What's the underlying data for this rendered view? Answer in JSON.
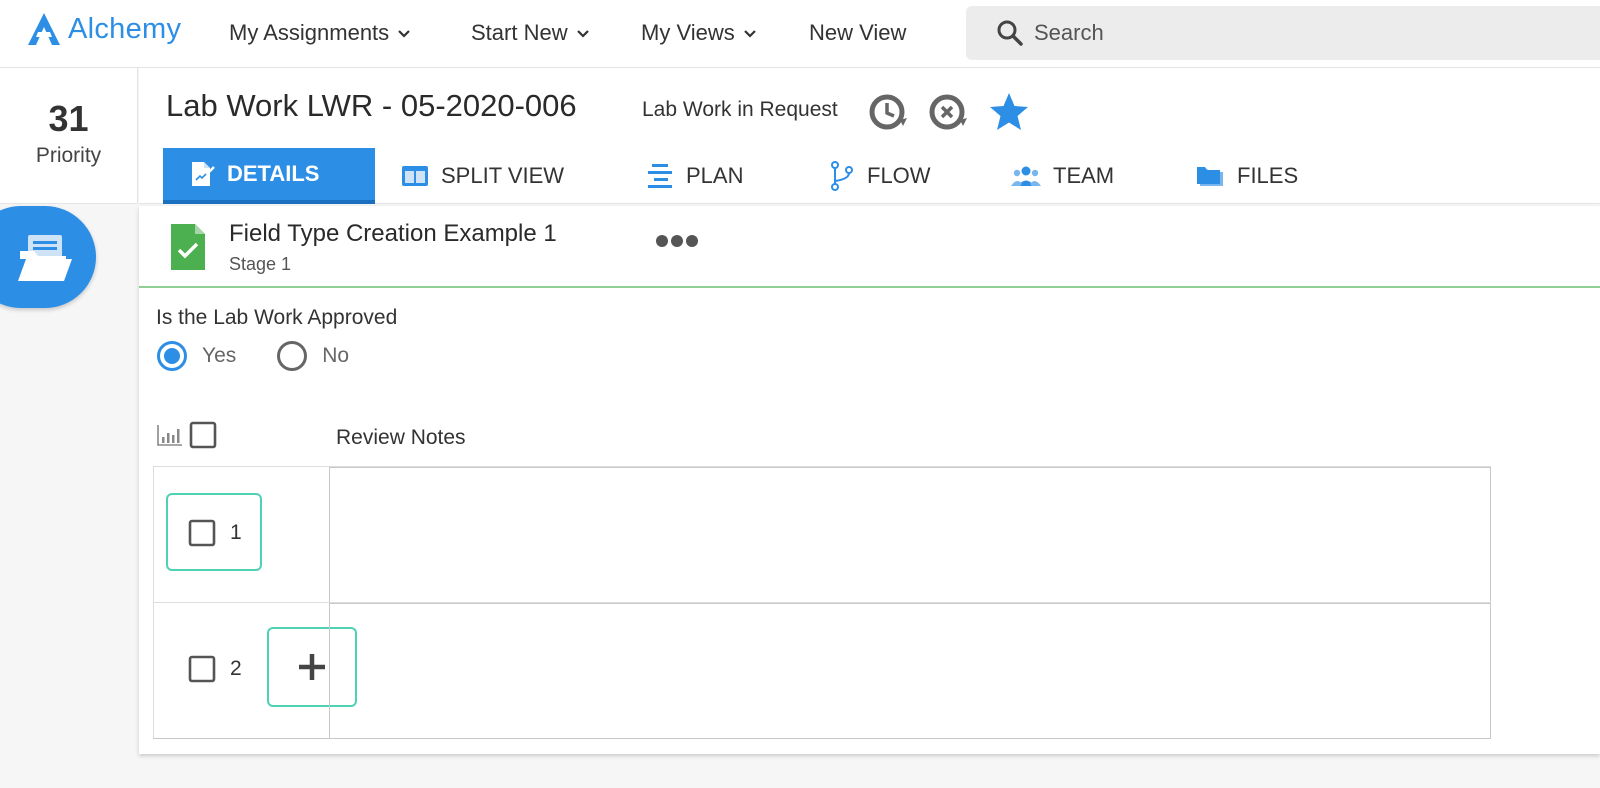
{
  "app": {
    "logo_text": "Alchemy",
    "accent_color": "#2d8ee6",
    "focus_color": "#4fd1b5"
  },
  "nav": {
    "items": [
      {
        "label": "My Assignments",
        "has_dropdown": true
      },
      {
        "label": "Start New",
        "has_dropdown": true
      },
      {
        "label": "My Views",
        "has_dropdown": true
      },
      {
        "label": "New View",
        "has_dropdown": false
      }
    ],
    "search_placeholder": "Search"
  },
  "priority": {
    "value": "31",
    "label": "Priority"
  },
  "record": {
    "title": "Lab Work LWR - 05-2020-006",
    "status": "Lab Work in Request",
    "icons": [
      "history-icon",
      "cancel-timer-icon",
      "star-icon"
    ]
  },
  "tabs": [
    {
      "label": "DETAILS",
      "icon": "details-icon",
      "active": true
    },
    {
      "label": "SPLIT VIEW",
      "icon": "split-view-icon",
      "active": false
    },
    {
      "label": "PLAN",
      "icon": "plan-icon",
      "active": false
    },
    {
      "label": "FLOW",
      "icon": "flow-icon",
      "active": false
    },
    {
      "label": "TEAM",
      "icon": "team-icon",
      "active": false
    },
    {
      "label": "FILES",
      "icon": "files-icon",
      "active": false
    }
  ],
  "card": {
    "title": "Field Type Creation Example 1",
    "stage": "Stage 1"
  },
  "approval": {
    "question": "Is the Lab Work Approved",
    "options": [
      {
        "label": "Yes",
        "selected": true
      },
      {
        "label": "No",
        "selected": false
      }
    ]
  },
  "grid": {
    "column_header": "Review Notes",
    "rows": [
      {
        "number": "1",
        "note": ""
      },
      {
        "number": "2",
        "note": ""
      }
    ]
  }
}
